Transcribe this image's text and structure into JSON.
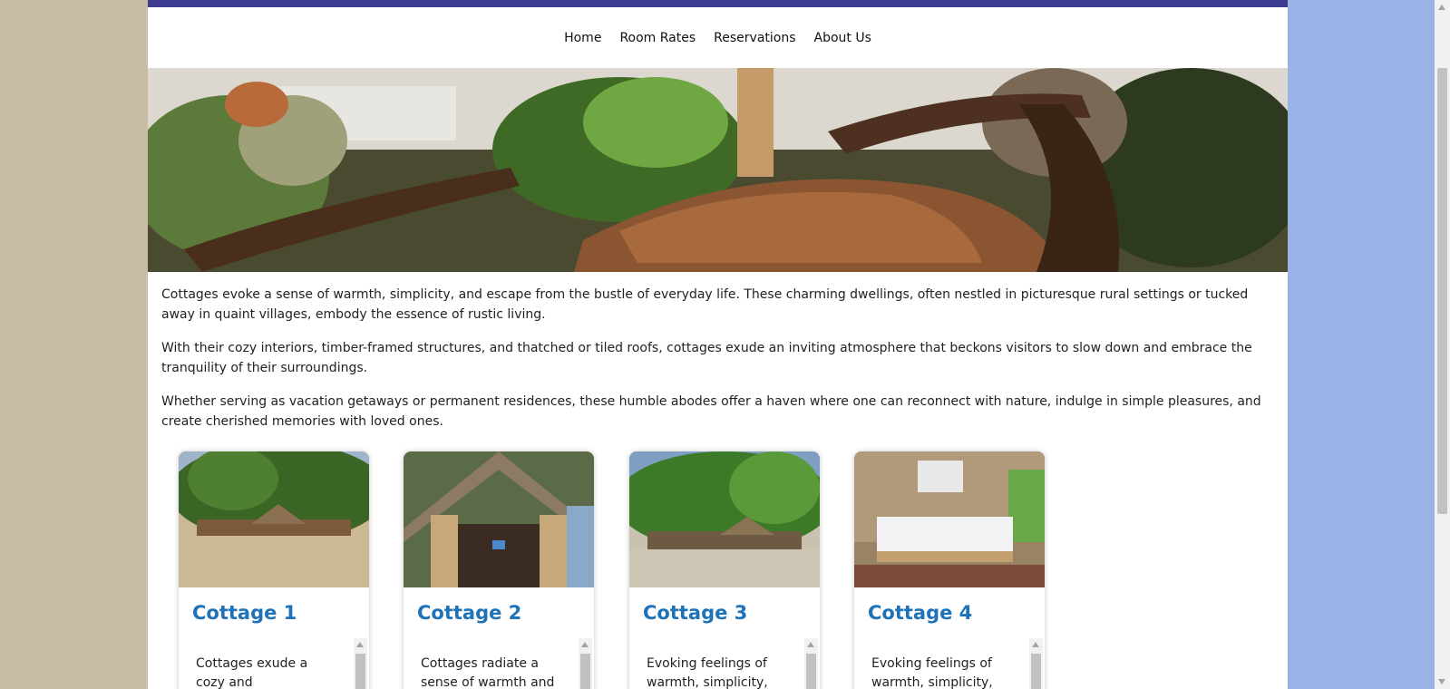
{
  "nav": {
    "items": [
      "Home",
      "Room Rates",
      "Reservations",
      "About Us"
    ]
  },
  "hero": {
    "icon": "patio-photo"
  },
  "intro": {
    "paragraphs": [
      "Cottages evoke a sense of warmth, simplicity, and escape from the bustle of everyday life. These charming dwellings, often nestled in picturesque rural settings or tucked away in quaint villages, embody the essence of rustic living.",
      "With their cozy interiors, timber-framed structures, and thatched or tiled roofs, cottages exude an inviting atmosphere that beckons visitors to slow down and embrace the tranquility of their surroundings.",
      "Whether serving as vacation getaways or permanent residences, these humble abodes offer a haven where one can reconnect with nature, indulge in simple pleasures, and create cherished memories with loved ones."
    ]
  },
  "cards": [
    {
      "title": "Cottage 1",
      "desc": "Cottages exude a cozy and uncomplicated"
    },
    {
      "title": "Cottage 2",
      "desc": "Cottages radiate a sense of warmth and"
    },
    {
      "title": "Cottage 3",
      "desc": "Evoking feelings of warmth, simplicity, and"
    },
    {
      "title": "Cottage 4",
      "desc": "Evoking feelings of warmth, simplicity, and"
    }
  ],
  "colors": {
    "topbar": "#3c3b8f",
    "card_title": "#1e73b8",
    "left_bg": "#c8bca4",
    "right_bg": "#9ab3e6"
  }
}
